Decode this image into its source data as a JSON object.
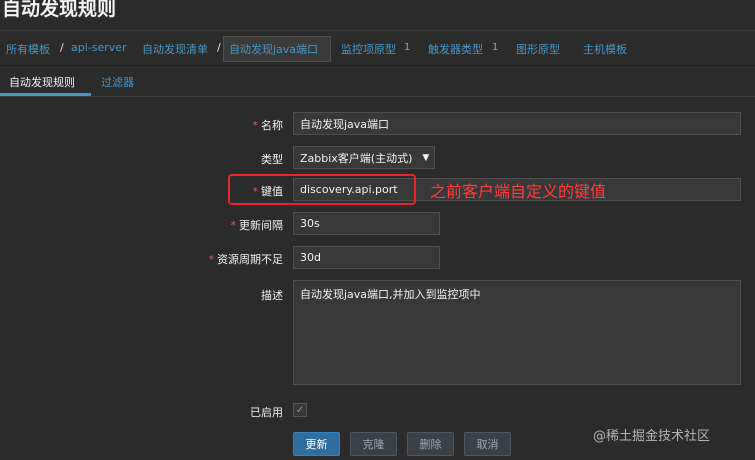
{
  "header": {
    "title": "自动发现规则"
  },
  "breadcrumb": {
    "all_templates": "所有模板",
    "separator": "/",
    "template": "api-server",
    "discovery_list": "自动发现清单",
    "current": "自动发现java端口"
  },
  "nav_tabs": {
    "item_prototypes": "监控项原型",
    "item_prototypes_count": "1",
    "trigger_prototypes": "触发器类型",
    "trigger_prototypes_count": "1",
    "graph_prototypes": "图形原型",
    "host_prototypes": "主机模板"
  },
  "tabs": {
    "discovery_rule": "自动发现规则",
    "filters": "过滤器"
  },
  "form": {
    "name_label": "名称",
    "name_value": "自动发现java端口",
    "type_label": "类型",
    "type_value": "Zabbix客户端(主动式)",
    "key_label": "键值",
    "key_value": "discovery.api.port",
    "interval_label": "更新间隔",
    "interval_value": "30s",
    "lifetime_label": "资源周期不足",
    "lifetime_value": "30d",
    "description_label": "描述",
    "description_value": "自动发现java端口,并加入到监控项中",
    "enabled_label": "已启用",
    "required_mark": "*"
  },
  "annotation": {
    "text": "之前客户端自定义的键值"
  },
  "buttons": {
    "update": "更新",
    "clone": "克隆",
    "delete": "删除",
    "cancel": "取消"
  },
  "watermark": {
    "text": "@稀土掘金技术社区"
  },
  "colors": {
    "background": "#2b2b2b",
    "link": "#4796c4",
    "highlight": "#e6262b",
    "primary_button": "#2f6c9f"
  }
}
